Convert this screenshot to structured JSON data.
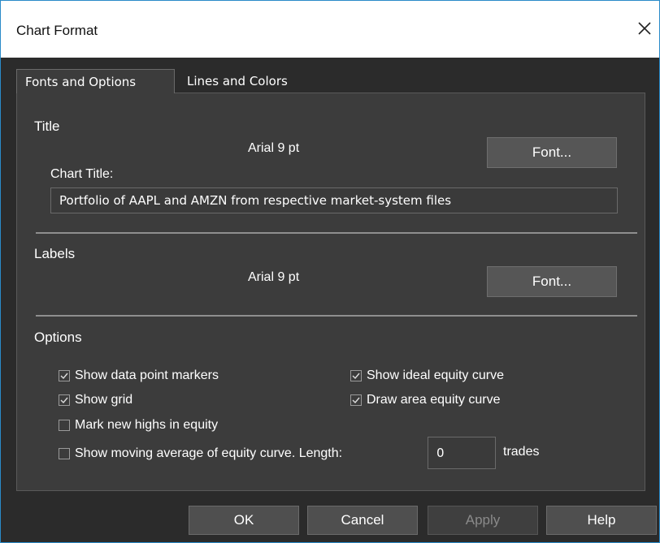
{
  "window": {
    "title": "Chart Format",
    "close_icon": "close-icon"
  },
  "tabs": [
    {
      "label": "Fonts and Options",
      "active": true
    },
    {
      "label": "Lines and Colors",
      "active": false
    }
  ],
  "title_section": {
    "heading": "Title",
    "font_display": "Arial 9 pt",
    "font_button": "Font...",
    "chart_title_label": "Chart Title:",
    "chart_title_value": "Portfolio of AAPL and AMZN from respective market-system files"
  },
  "labels_section": {
    "heading": "Labels",
    "font_display": "Arial 9 pt",
    "font_button": "Font..."
  },
  "options_section": {
    "heading": "Options",
    "checkboxes": [
      {
        "label": "Show data point markers",
        "checked": true
      },
      {
        "label": "Show ideal equity curve",
        "checked": true
      },
      {
        "label": "Show grid",
        "checked": true
      },
      {
        "label": "Draw area equity curve",
        "checked": true
      },
      {
        "label": "Mark new highs in equity",
        "checked": false
      },
      {
        "label": "Show moving average of equity curve. Length:",
        "checked": false
      }
    ],
    "length_value": "0",
    "length_unit": "trades"
  },
  "footer": {
    "ok": "OK",
    "cancel": "Cancel",
    "apply": "Apply",
    "help": "Help"
  },
  "colors": {
    "background": "#2b2b2b",
    "panel": "#3c3c3c",
    "button": "#565656",
    "accent_border": "#2a8bc9"
  }
}
